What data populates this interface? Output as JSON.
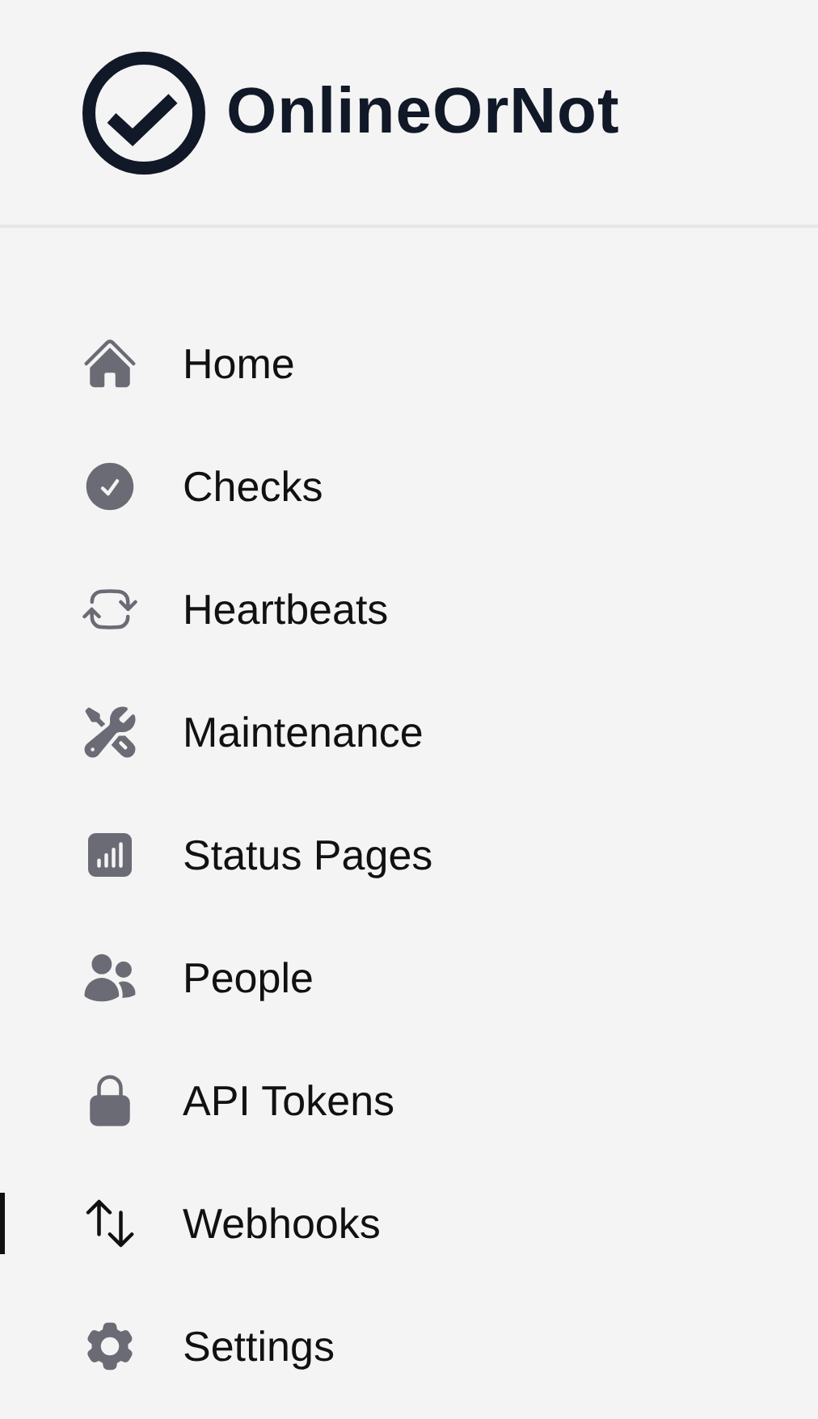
{
  "brand": {
    "name": "OnlineOrNot"
  },
  "nav": [
    {
      "label": "Home",
      "selected": false
    },
    {
      "label": "Checks",
      "selected": false
    },
    {
      "label": "Heartbeats",
      "selected": false
    },
    {
      "label": "Maintenance",
      "selected": false
    },
    {
      "label": "Status Pages",
      "selected": false
    },
    {
      "label": "People",
      "selected": false
    },
    {
      "label": "API Tokens",
      "selected": false
    },
    {
      "label": "Webhooks",
      "selected": true
    },
    {
      "label": "Settings",
      "selected": false
    }
  ]
}
